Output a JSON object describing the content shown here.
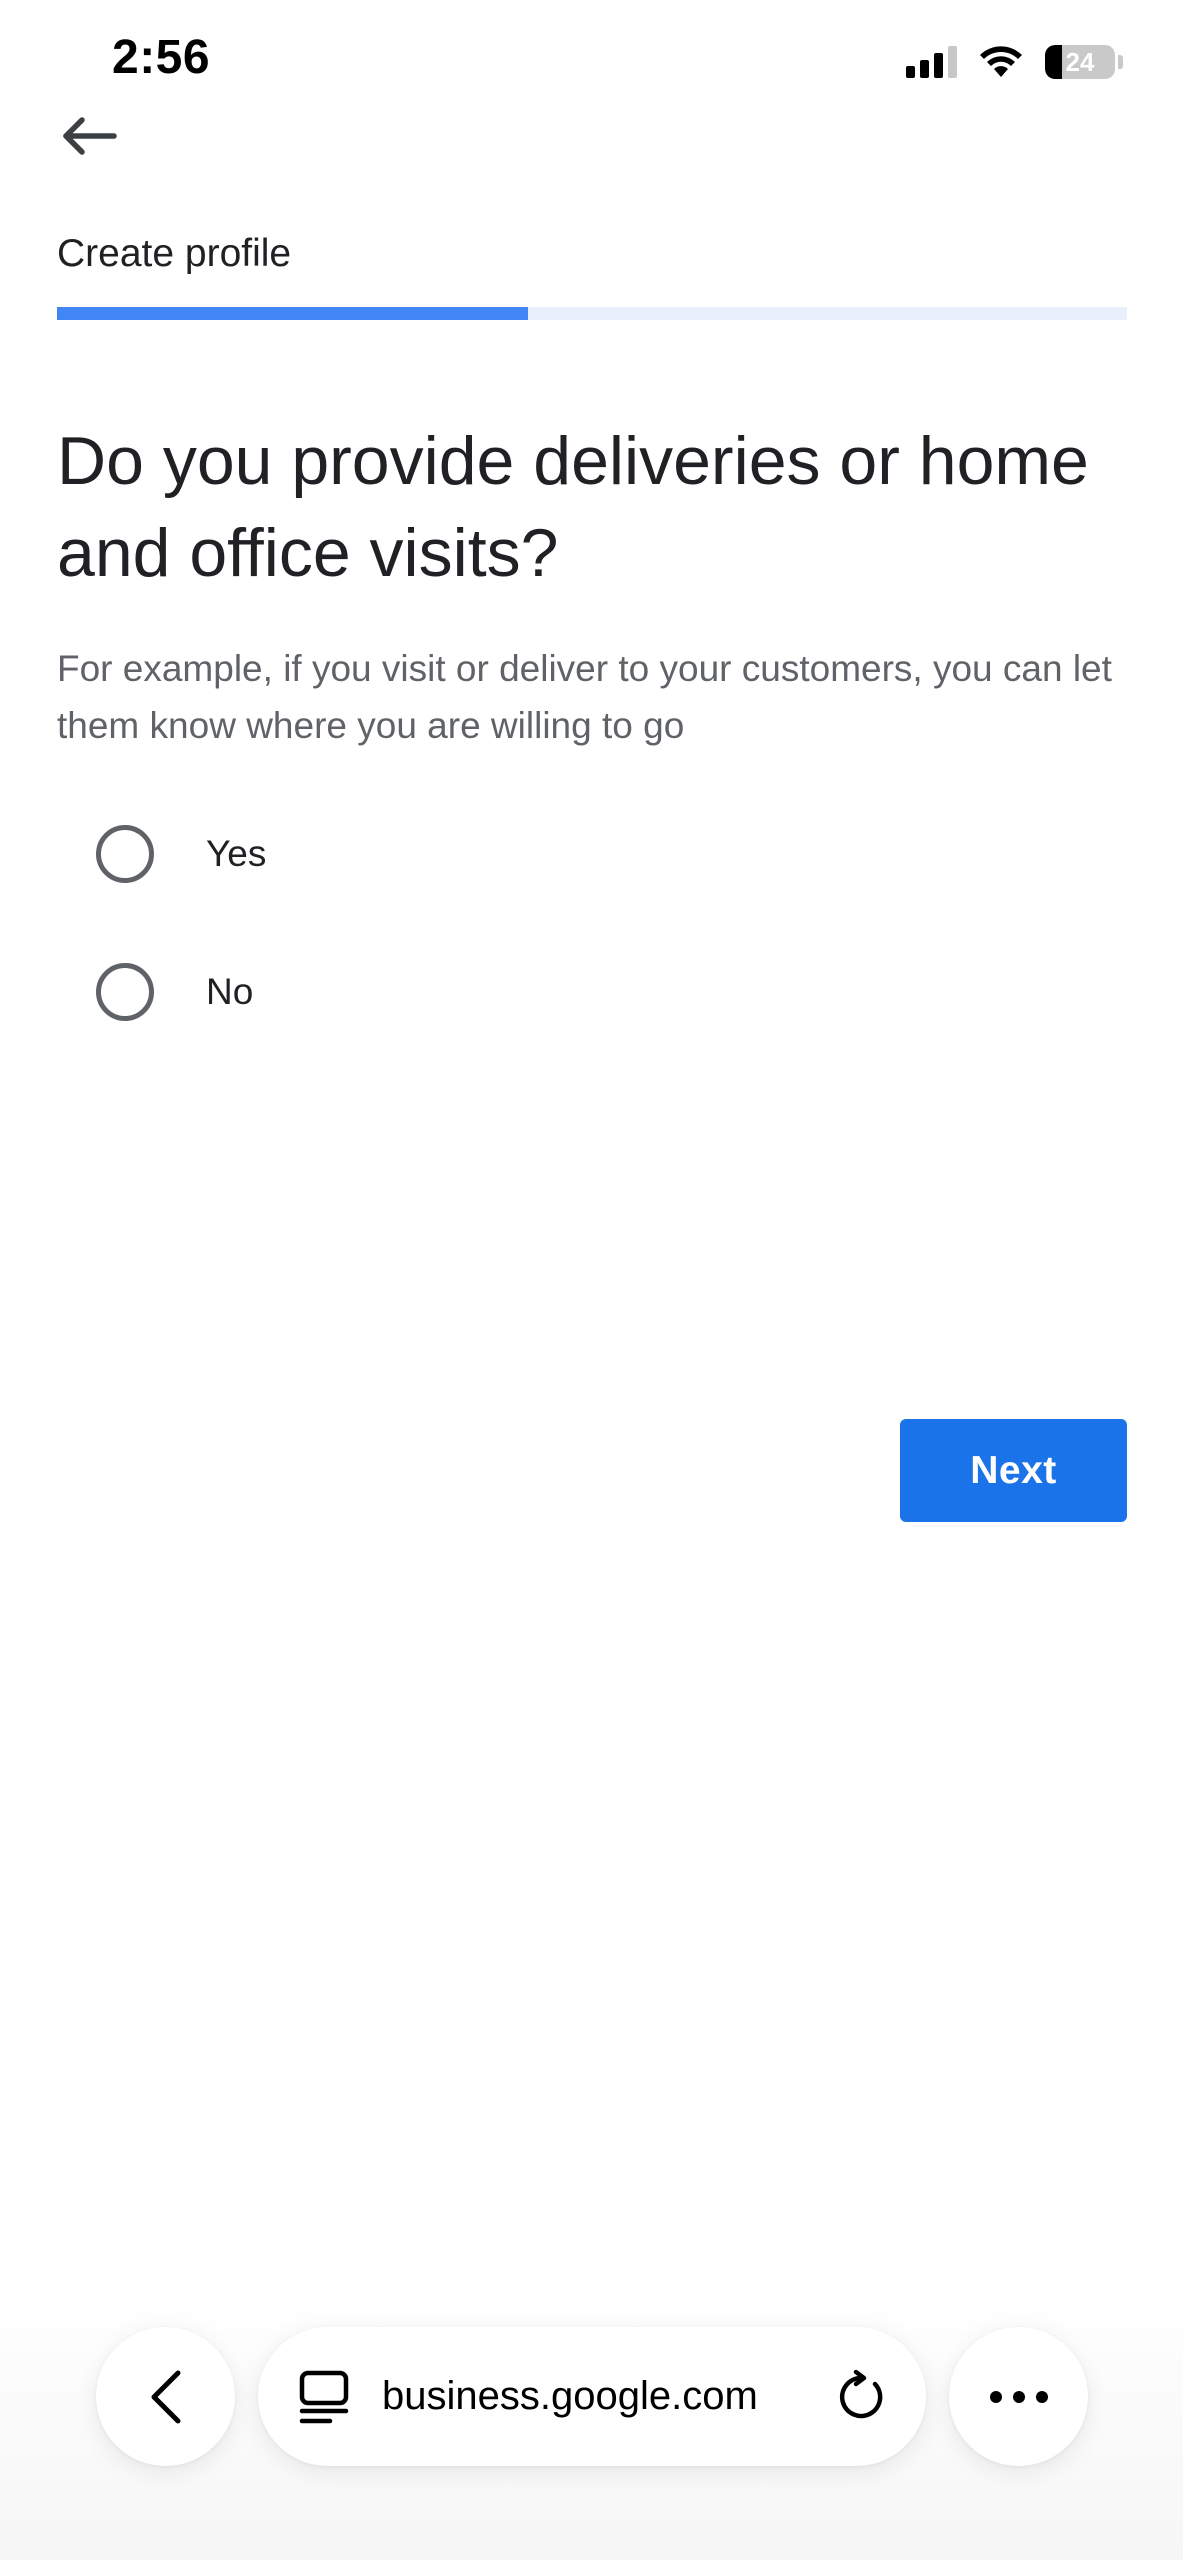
{
  "status_bar": {
    "time": "2:56",
    "battery_percent": "24",
    "battery_level": 0.24,
    "signal_bars_active": 3,
    "icons": [
      "signal-icon",
      "wifi-icon",
      "battery-icon"
    ]
  },
  "header": {
    "back_icon": "arrow-left-icon",
    "title": "Create profile",
    "progress": 0.44
  },
  "question": {
    "title": "Do you provide deliveries or home and office visits?",
    "description": "For example, if you visit or deliver to your customers, you can let them know where you are willing to go",
    "options": [
      {
        "label": "Yes",
        "selected": false
      },
      {
        "label": "No",
        "selected": false
      }
    ]
  },
  "actions": {
    "next_label": "Next"
  },
  "browser_bar": {
    "url": "business.google.com",
    "icons": [
      "chevron-left-icon",
      "tab-overview-icon",
      "reload-icon",
      "more-icon"
    ]
  },
  "colors": {
    "accent": "#1a73e8",
    "progress_fill": "#4285f4",
    "progress_track": "#e8f0fe",
    "text_primary": "#202124",
    "text_secondary": "#5f6368"
  }
}
